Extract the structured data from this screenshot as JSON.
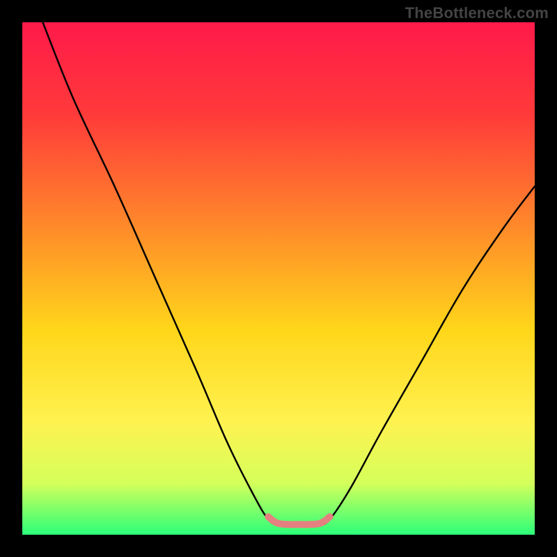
{
  "watermark": "TheBottleneck.com",
  "chart_data": {
    "type": "line",
    "title": "",
    "xlabel": "",
    "ylabel": "",
    "xlim": [
      0,
      100
    ],
    "ylim": [
      0,
      100
    ],
    "gradient_stops": [
      {
        "offset": 0,
        "color": "#ff1a4a"
      },
      {
        "offset": 18,
        "color": "#ff3a3a"
      },
      {
        "offset": 40,
        "color": "#ff8a2a"
      },
      {
        "offset": 60,
        "color": "#ffd61a"
      },
      {
        "offset": 78,
        "color": "#fff250"
      },
      {
        "offset": 90,
        "color": "#d4ff5a"
      },
      {
        "offset": 100,
        "color": "#2bff7a"
      }
    ],
    "series": [
      {
        "name": "bottleneck-curve",
        "color": "#000000",
        "width": 2.5,
        "points": [
          {
            "x": 4,
            "y": 100
          },
          {
            "x": 10,
            "y": 85
          },
          {
            "x": 18,
            "y": 68
          },
          {
            "x": 26,
            "y": 50
          },
          {
            "x": 34,
            "y": 32
          },
          {
            "x": 40,
            "y": 18
          },
          {
            "x": 45,
            "y": 8
          },
          {
            "x": 48,
            "y": 3
          },
          {
            "x": 50,
            "y": 2
          },
          {
            "x": 54,
            "y": 2
          },
          {
            "x": 58,
            "y": 2
          },
          {
            "x": 60,
            "y": 3
          },
          {
            "x": 64,
            "y": 9
          },
          {
            "x": 70,
            "y": 20
          },
          {
            "x": 78,
            "y": 34
          },
          {
            "x": 86,
            "y": 48
          },
          {
            "x": 94,
            "y": 60
          },
          {
            "x": 100,
            "y": 68
          }
        ]
      },
      {
        "name": "optimal-zone",
        "color": "#e58080",
        "width": 10,
        "cap": "round",
        "points": [
          {
            "x": 48,
            "y": 3.5
          },
          {
            "x": 50,
            "y": 2.2
          },
          {
            "x": 54,
            "y": 2
          },
          {
            "x": 58,
            "y": 2.2
          },
          {
            "x": 60,
            "y": 3.5
          }
        ]
      }
    ]
  }
}
